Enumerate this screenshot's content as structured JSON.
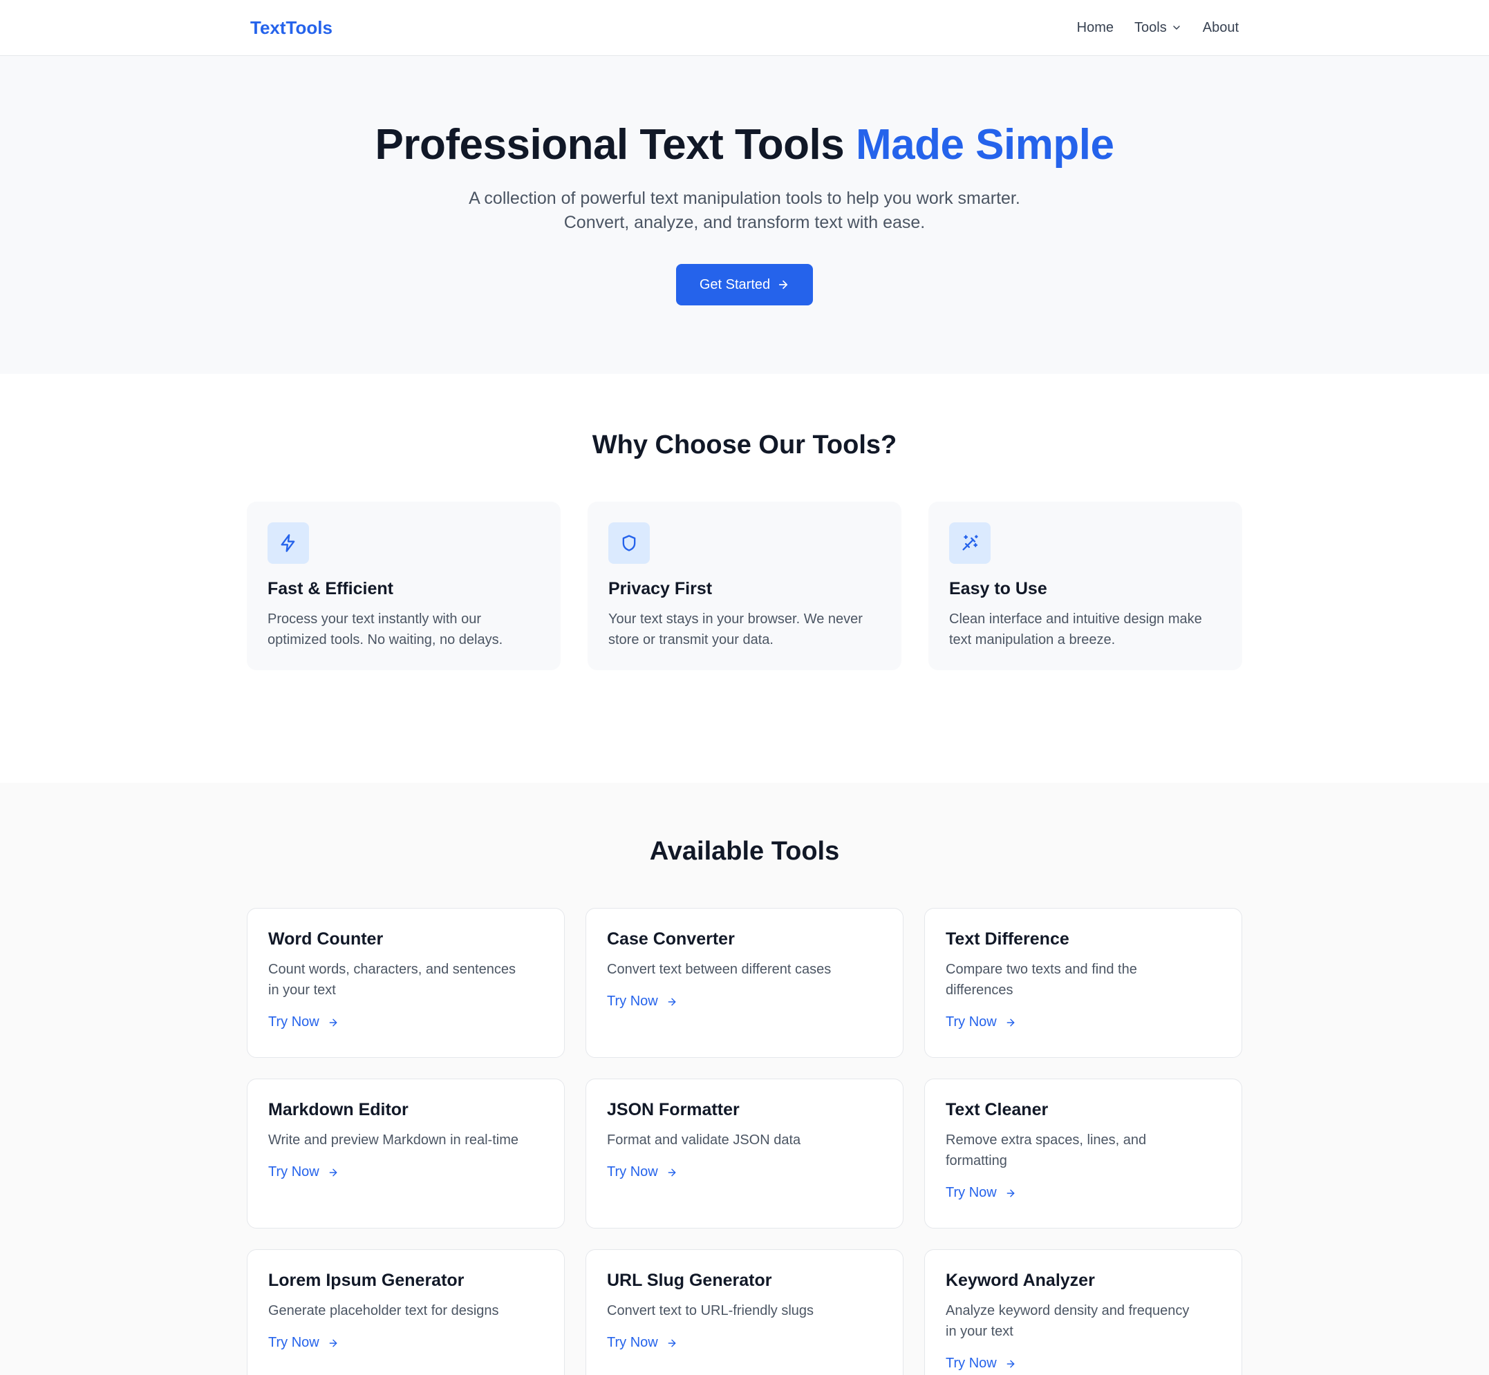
{
  "nav": {
    "brand": "TextTools",
    "links": [
      {
        "label": "Home"
      },
      {
        "label": "Tools",
        "icon": "chevron-down-icon"
      },
      {
        "label": "About"
      }
    ]
  },
  "hero": {
    "title_main": "Professional Text Tools",
    "title_accent": "Made Simple",
    "subtitle_line1": "A collection of powerful text manipulation tools to help you work smarter.",
    "subtitle_line2": "Convert, analyze, and transform text with ease.",
    "cta_label": "Get Started",
    "cta_icon": "arrow-right-icon"
  },
  "features": {
    "title": "Why Choose Our Tools?",
    "items": [
      {
        "icon": "lightning-icon",
        "title": "Fast & Efficient",
        "desc_line1": "Process your text instantly with our",
        "desc_line2": "optimized tools. No waiting, no delays."
      },
      {
        "icon": "shield-icon",
        "title": "Privacy First",
        "desc_line1": "Your text stays in your browser. We never",
        "desc_line2": "store or transmit your data."
      },
      {
        "icon": "magic-wand-icon",
        "title": "Easy to Use",
        "desc_line1": "Clean interface and intuitive design make",
        "desc_line2": "text manipulation a breeze."
      }
    ]
  },
  "tools": {
    "title": "Available Tools",
    "try_label": "Try Now",
    "items": [
      {
        "title": "Word Counter",
        "desc_line1": "Count words, characters, and sentences",
        "desc_line2": "in your text"
      },
      {
        "title": "Case Converter",
        "desc_line1": "Convert text between different cases",
        "desc_line2": ""
      },
      {
        "title": "Text Difference",
        "desc_line1": "Compare two texts and find the",
        "desc_line2": "differences"
      },
      {
        "title": "Markdown Editor",
        "desc_line1": "Write and preview Markdown in real-time",
        "desc_line2": ""
      },
      {
        "title": "JSON Formatter",
        "desc_line1": "Format and validate JSON data",
        "desc_line2": ""
      },
      {
        "title": "Text Cleaner",
        "desc_line1": "Remove extra spaces, lines, and",
        "desc_line2": "formatting"
      },
      {
        "title": "Lorem Ipsum Generator",
        "desc_line1": "Generate placeholder text for designs",
        "desc_line2": ""
      },
      {
        "title": "URL Slug Generator",
        "desc_line1": "Convert text to URL-friendly slugs",
        "desc_line2": ""
      },
      {
        "title": "Keyword Analyzer",
        "desc_line1": "Analyze keyword density and frequency",
        "desc_line2": "in your text"
      }
    ]
  },
  "colors": {
    "accent": "#2563eb",
    "text_dark": "#111827",
    "text_muted": "#4b5563",
    "icon_bg": "#dbeafe"
  }
}
